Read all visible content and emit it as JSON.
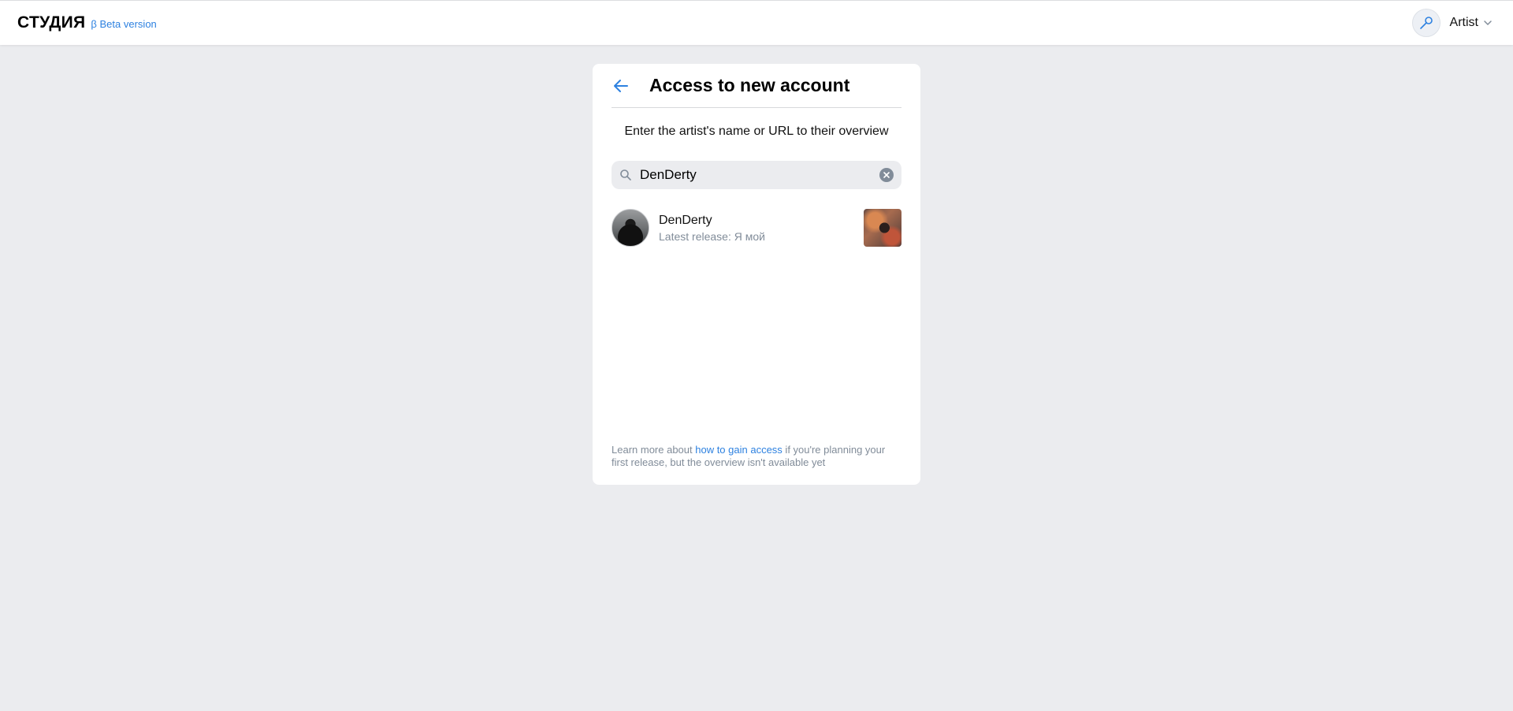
{
  "header": {
    "logo": "СТУДИЯ",
    "beta_label": "β Beta version",
    "account_label": "Artist"
  },
  "card": {
    "title": "Access to new account",
    "hint": "Enter the artist's name or URL to their overview",
    "search": {
      "value": "DenDerty"
    },
    "result": {
      "name": "DenDerty",
      "subtitle": "Latest release: Я мой"
    },
    "footer": {
      "prefix": "Learn more about ",
      "link": "how to gain access",
      "suffix": " if you're planning your first release, but the overview isn't available yet"
    }
  },
  "colors": {
    "accent": "#2d81e0",
    "secondary_text": "#818c99",
    "page_background": "#ebecef"
  },
  "icons": [
    "arrow-left-icon",
    "search-icon",
    "clear-icon",
    "chevron-down-icon",
    "key-icon"
  ]
}
